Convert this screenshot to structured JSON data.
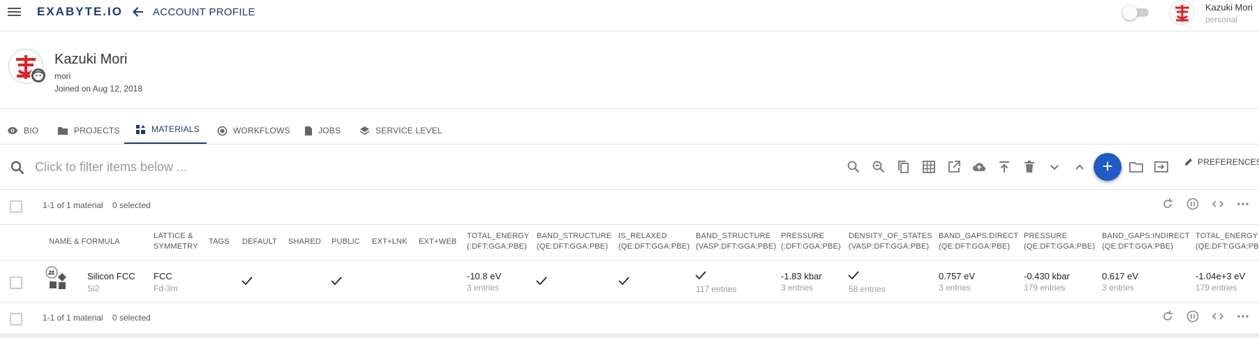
{
  "header": {
    "logo": "EXABYTE.IO",
    "page_title": "ACCOUNT PROFILE",
    "user_name": "Kazuki Mori",
    "user_plan": "personal"
  },
  "profile": {
    "name": "Kazuki Mori",
    "username": "mori",
    "joined": "Joined on Aug 12, 2018"
  },
  "tabs": [
    {
      "label": "BIO",
      "icon": "eye-icon"
    },
    {
      "label": "PROJECTS",
      "icon": "folder-icon"
    },
    {
      "label": "MATERIALS",
      "icon": "dashboard-icon",
      "active": true
    },
    {
      "label": "WORKFLOWS",
      "icon": "radio-icon"
    },
    {
      "label": "JOBS",
      "icon": "file-icon"
    },
    {
      "label": "SERVICE LEVEL",
      "icon": "layers-icon"
    }
  ],
  "search": {
    "placeholder": "Click to filter items below ..."
  },
  "toolbar": {
    "icons": [
      "search-icon",
      "zoom-out-icon",
      "copy-icon",
      "grid-icon",
      "open-external-icon",
      "cloud-upload-icon",
      "publish-icon",
      "delete-icon",
      "chevron-down-icon",
      "chevron-up-icon",
      "add-icon",
      "folder-open-icon",
      "move-icon"
    ],
    "fab_label": "+",
    "preferences_label": "PREFERENCES"
  },
  "summary": {
    "count_top": "1-1 of 1 material",
    "selected_top": "0 selected",
    "count_bottom": "1-1 of 1 material",
    "selected_bottom": "0 selected"
  },
  "table": {
    "headers": [
      {
        "line1": "NAME & FORMULA",
        "line2": ""
      },
      {
        "line1": "LATTICE &",
        "line2": "SYMMETRY"
      },
      {
        "line1": "TAGS",
        "line2": ""
      },
      {
        "line1": "DEFAULT",
        "line2": ""
      },
      {
        "line1": "SHARED",
        "line2": ""
      },
      {
        "line1": "PUBLIC",
        "line2": ""
      },
      {
        "line1": "EXT+LNK",
        "line2": ""
      },
      {
        "line1": "EXT+WEB",
        "line2": ""
      },
      {
        "line1": "TOTAL_ENERGY",
        "line2": "(:DFT:GGA:PBE)"
      },
      {
        "line1": "BAND_STRUCTURE",
        "line2": "(QE:DFT:GGA:PBE)"
      },
      {
        "line1": "IS_RELAXED",
        "line2": "(QE:DFT:GGA:PBE)"
      },
      {
        "line1": "BAND_STRUCTURE",
        "line2": "(VASP:DFT:GGA:PBE)"
      },
      {
        "line1": "PRESSURE",
        "line2": "(:DFT:GGA:PBE)"
      },
      {
        "line1": "DENSITY_OF_STATES",
        "line2": "(VASP:DFT:GGA:PBE)"
      },
      {
        "line1": "BAND_GAPS:DIRECT",
        "line2": "(QE:DFT:GGA:PBE)"
      },
      {
        "line1": "PRESSURE",
        "line2": "(QE:DFT:GGA:PBE)"
      },
      {
        "line1": "BAND_GAPS:INDIRECT",
        "line2": "(QE:DFT:GGA:PBE)"
      },
      {
        "line1": "TOTAL_ENERGY",
        "line2": "(QE:DFT:GGA:PBE)"
      }
    ],
    "row": {
      "name": "Silicon FCC",
      "formula": "Si2",
      "lattice": "FCC",
      "symmetry": "Fd-3m",
      "total_energy": "-10.8 eV",
      "total_energy_entries": "3 entries",
      "band_structure_vasp_entries": "117 entries",
      "pressure": "-1.83 kbar",
      "pressure_entries": "3 entries",
      "dos_entries": "58 entries",
      "band_gaps_direct": "0.757 eV",
      "band_gaps_direct_entries": "3 entries",
      "pressure_qe": "-0.430 kbar",
      "pressure_qe_entries": "179 entries",
      "band_gaps_indirect": "0.617 eV",
      "band_gaps_indirect_entries": "3 entries",
      "total_energy_qe": "-1.04e+3 eV",
      "total_energy_qe_entries": "179 entries"
    }
  },
  "colors": {
    "primary": "#1e3b70",
    "fab": "#1e5bc6"
  }
}
